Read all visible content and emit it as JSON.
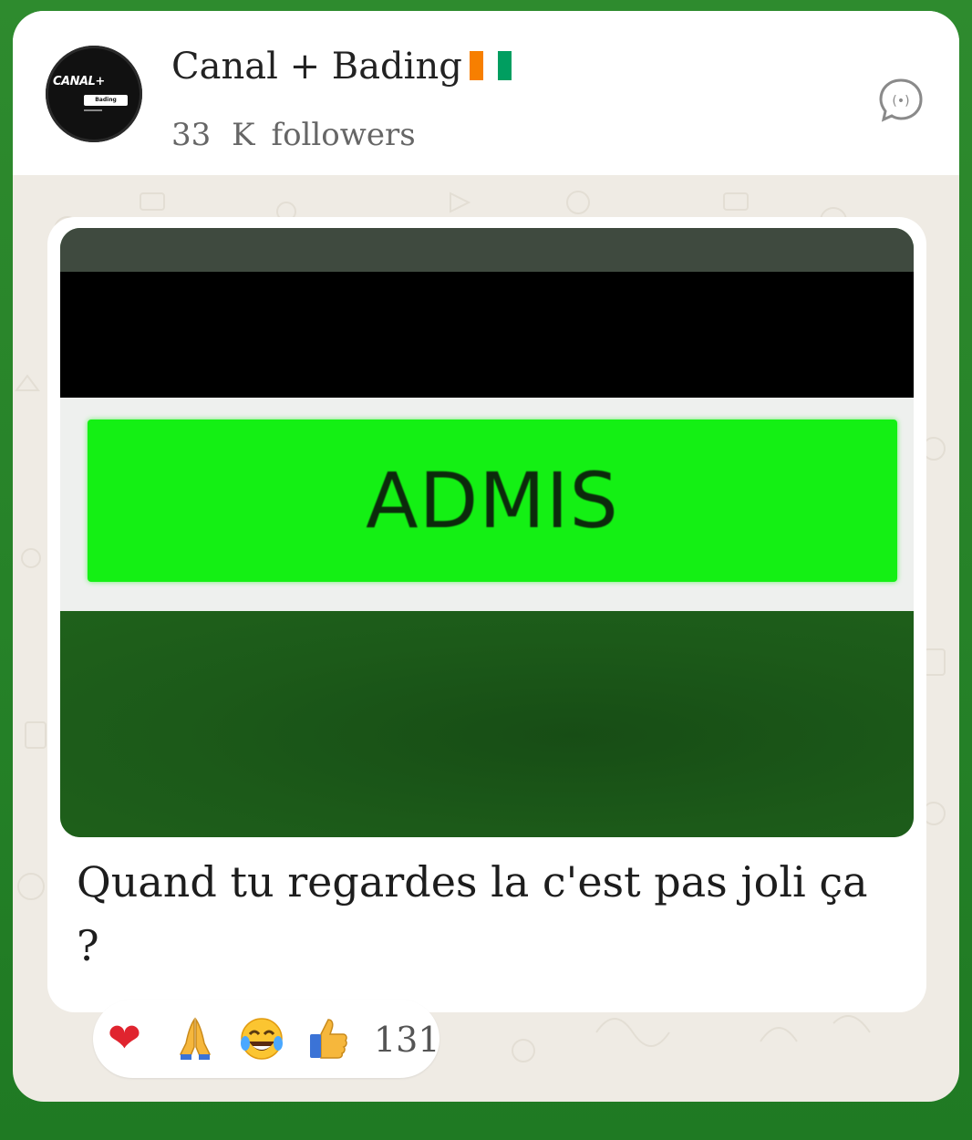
{
  "channel": {
    "name": "Canal + Bading",
    "followers_count": "33 K",
    "followers_label": "followers",
    "avatar_text": "CANAL+",
    "avatar_subtext": "Bading",
    "flag_colors": [
      "#f77f00",
      "#ffffff",
      "#009e60"
    ]
  },
  "post": {
    "image_label": "ADMIS",
    "caption": "Quand tu regardes la c'est pas joli ça ?"
  },
  "reactions": {
    "emojis": [
      "heart",
      "folded-hands",
      "tears-of-joy",
      "thumbs-up"
    ],
    "count": "131"
  },
  "colors": {
    "background": "#1f7a23",
    "admis_green": "#14f014",
    "dark_green": "#1c5a19"
  }
}
